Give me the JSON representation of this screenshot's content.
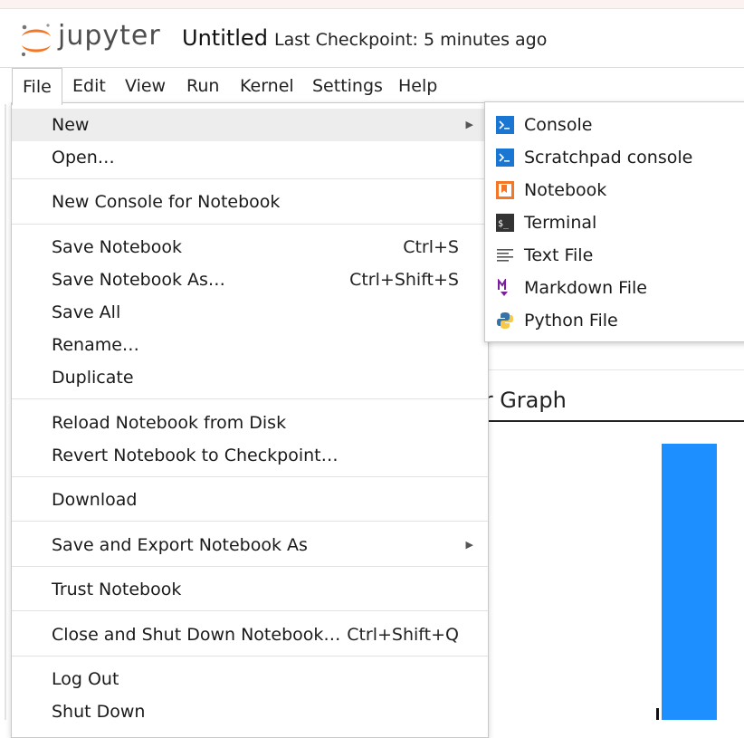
{
  "header": {
    "wordmark": "jupyter",
    "notebook_title": "Untitled",
    "checkpoint": "Last Checkpoint: 5 minutes ago"
  },
  "menubar": [
    "File",
    "Edit",
    "View",
    "Run",
    "Kernel",
    "Settings",
    "Help"
  ],
  "file_menu": {
    "new": "New",
    "open": "Open…",
    "new_console": "New Console for Notebook",
    "save": "Save Notebook",
    "save_sc": "Ctrl+S",
    "save_as": "Save Notebook As…",
    "save_as_sc": "Ctrl+Shift+S",
    "save_all": "Save All",
    "rename": "Rename…",
    "duplicate": "Duplicate",
    "reload": "Reload Notebook from Disk",
    "revert": "Revert Notebook to Checkpoint…",
    "download": "Download",
    "export": "Save and Export Notebook As",
    "trust": "Trust Notebook",
    "close": "Close and Shut Down Notebook…",
    "close_sc": "Ctrl+Shift+Q",
    "logout": "Log Out",
    "shutdown": "Shut Down"
  },
  "new_submenu": {
    "console": "Console",
    "scratchpad": "Scratchpad console",
    "notebook": "Notebook",
    "terminal": "Terminal",
    "textfile": "Text File",
    "markdown": "Markdown File",
    "python": "Python File"
  },
  "background": {
    "chart_title_fragment": "ar Graph"
  },
  "colors": {
    "bar": "#1e8fff",
    "jupyter_orange": "#f37726",
    "console_blue": "#1976d2",
    "markdown_purple": "#7b1fa2"
  }
}
